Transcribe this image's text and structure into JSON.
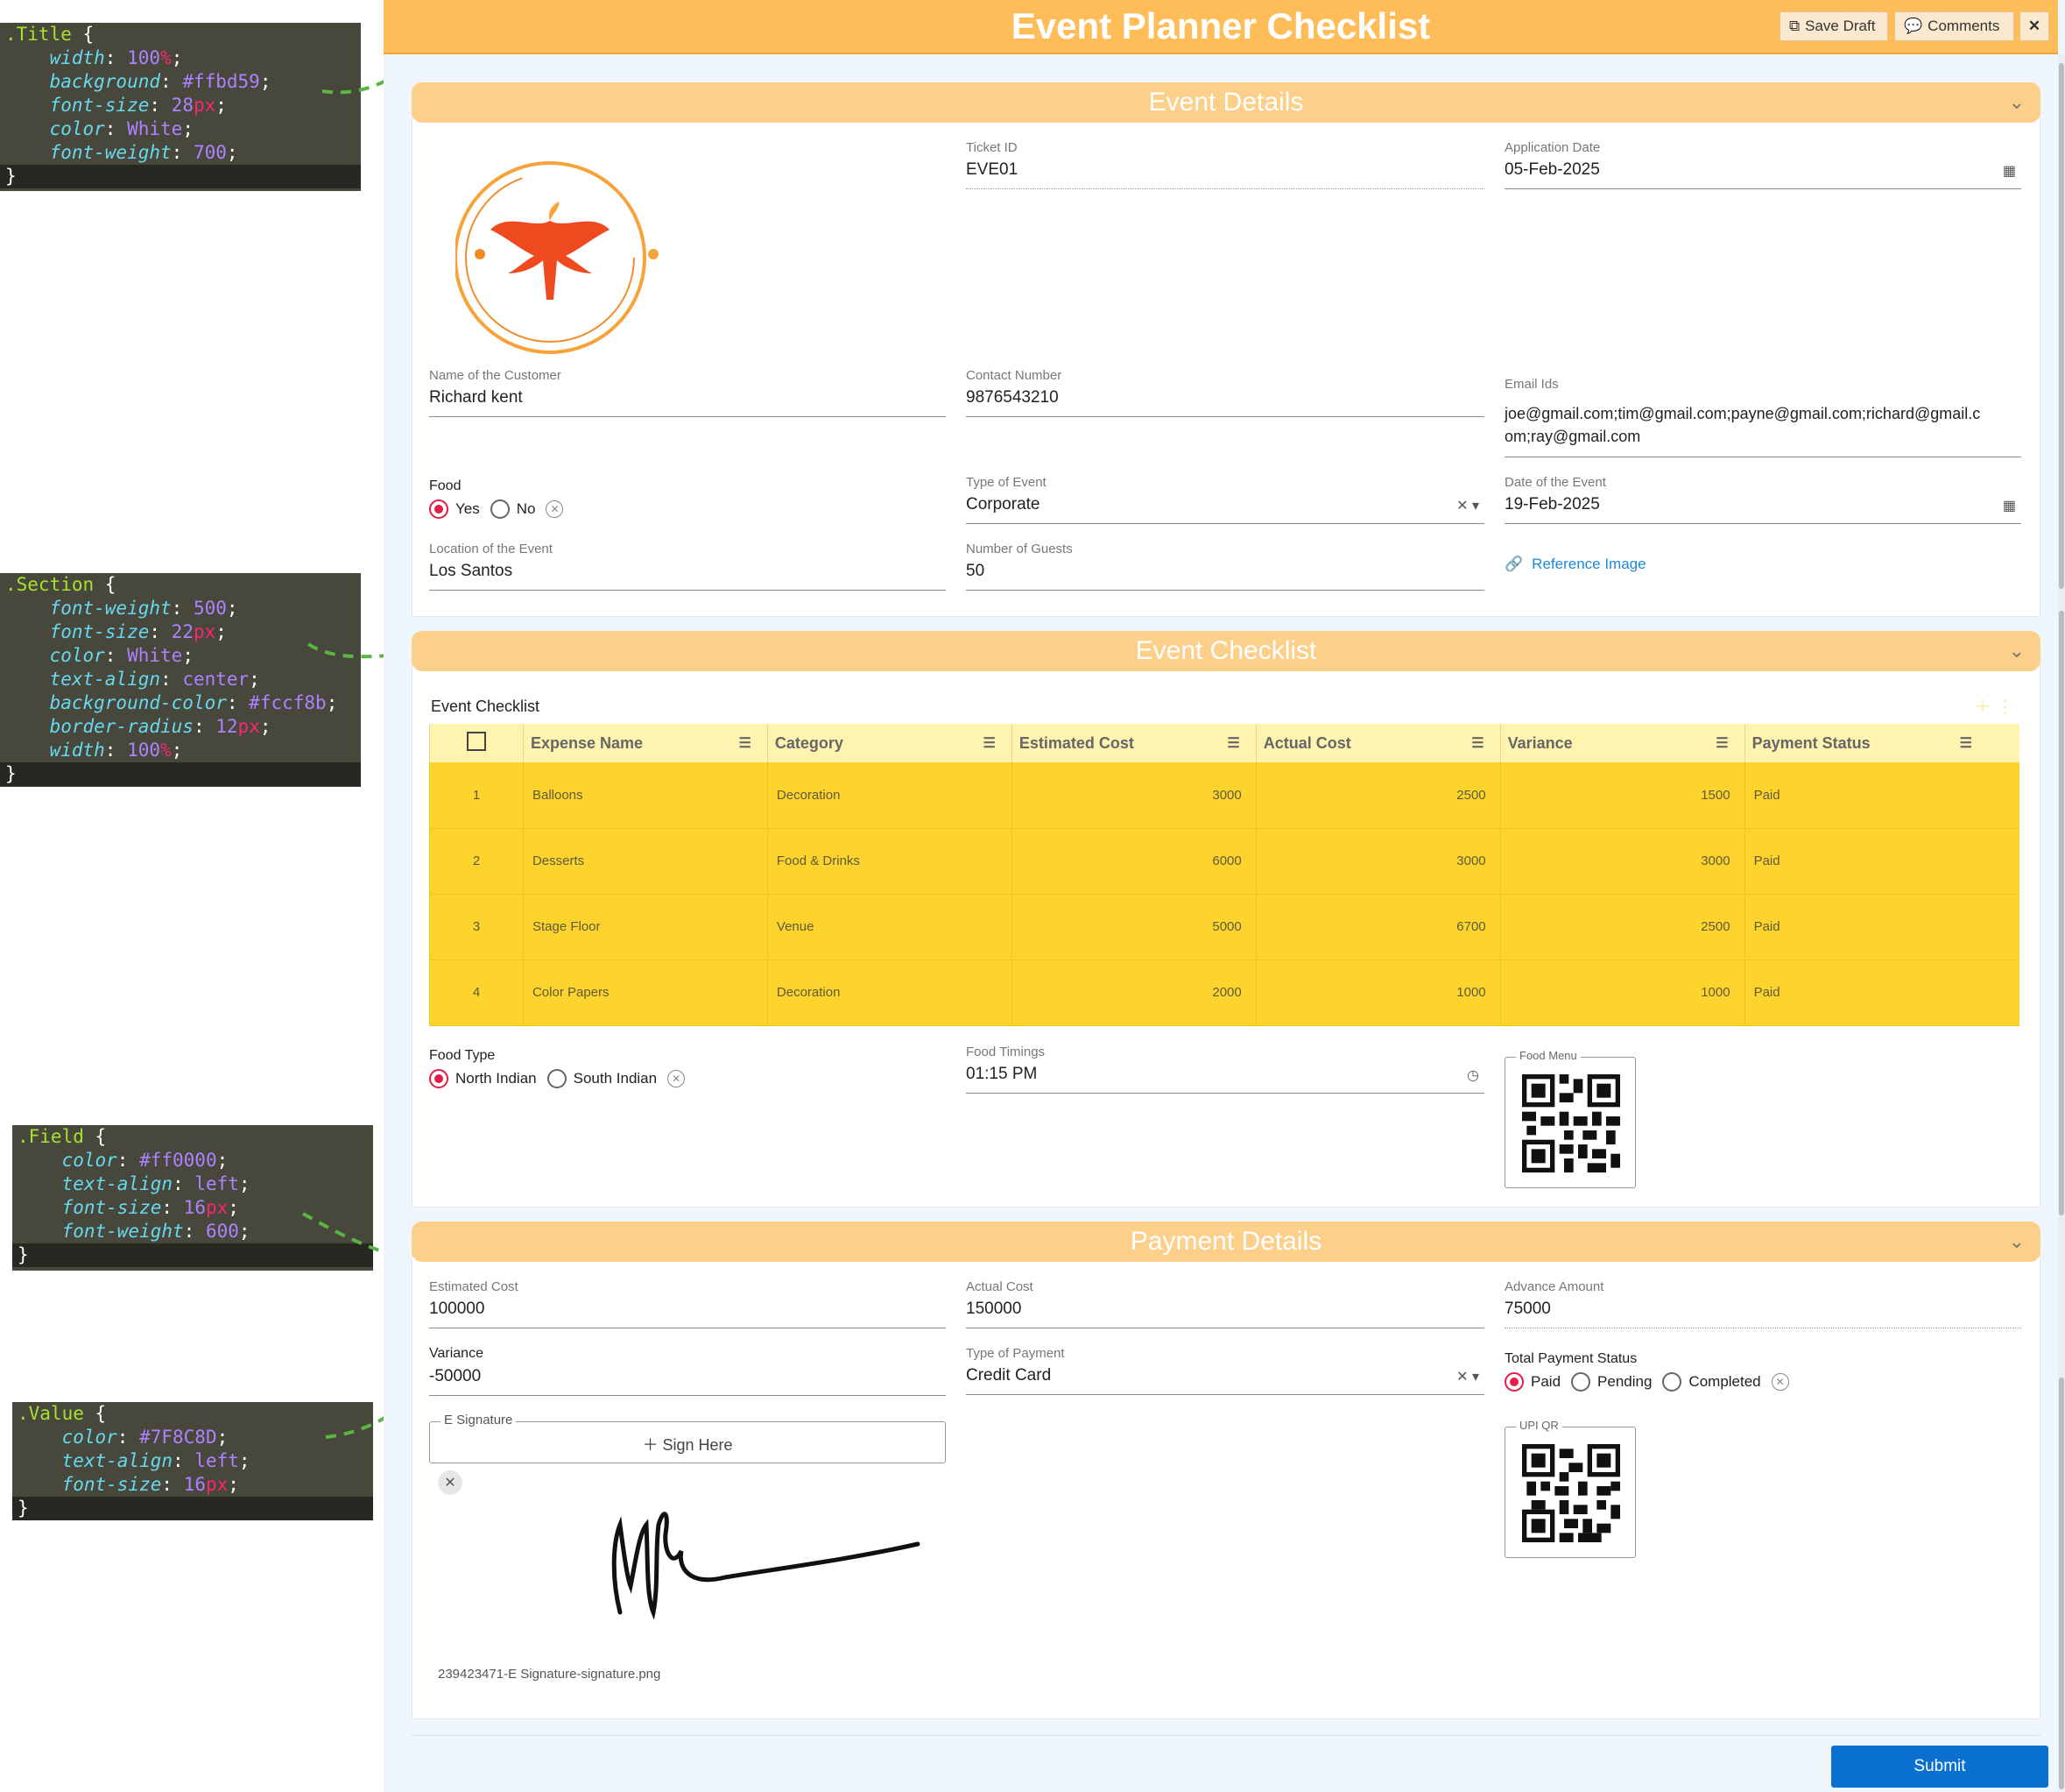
{
  "annotations": {
    "title_css": {
      "selector": ".Title",
      "lines": [
        {
          "prop": "width",
          "value": "100",
          "unit": "%"
        },
        {
          "prop": "background",
          "value": "#ffbd59",
          "unit": ""
        },
        {
          "prop": "font-size",
          "value": "28",
          "unit": "px"
        },
        {
          "prop": "color",
          "value": "White",
          "unit": ""
        },
        {
          "prop": "font-weight",
          "value": "700",
          "unit": ""
        }
      ]
    },
    "section_css": {
      "selector": ".Section",
      "lines": [
        {
          "prop": "font-weight",
          "value": "500",
          "unit": ""
        },
        {
          "prop": "font-size",
          "value": "22",
          "unit": "px"
        },
        {
          "prop": "color",
          "value": "White",
          "unit": ""
        },
        {
          "prop": "text-align",
          "value": "center",
          "unit": ""
        },
        {
          "prop": "background-color",
          "value": "#fccf8b",
          "unit": ""
        },
        {
          "prop": "border-radius",
          "value": "12",
          "unit": "px"
        },
        {
          "prop": "width",
          "value": "100",
          "unit": "%"
        }
      ]
    },
    "field_css": {
      "selector": ".Field",
      "lines": [
        {
          "prop": "color",
          "value": "#ff0000",
          "unit": ""
        },
        {
          "prop": "text-align",
          "value": "left",
          "unit": ""
        },
        {
          "prop": "font-size",
          "value": "16",
          "unit": "px"
        },
        {
          "prop": "font-weight",
          "value": "600",
          "unit": ""
        }
      ]
    },
    "value_css": {
      "selector": ".Value",
      "lines": [
        {
          "prop": "color",
          "value": "#7F8C8D",
          "unit": ""
        },
        {
          "prop": "text-align",
          "value": "left",
          "unit": ""
        },
        {
          "prop": "font-size",
          "value": "16",
          "unit": "px"
        }
      ]
    }
  },
  "header": {
    "title": "Event Planner Checklist",
    "save_draft": "Save Draft",
    "comments": "Comments",
    "close": "✕"
  },
  "event_details": {
    "section_title": "Event Details",
    "ticket_id_label": "Ticket ID",
    "ticket_id": "EVE01",
    "application_date_label": "Application Date",
    "application_date": "05-Feb-2025",
    "customer_label": "Name of the Customer",
    "customer": "Richard kent",
    "contact_label": "Contact Number",
    "contact": "9876543210",
    "email_label": "Email Ids",
    "email_line1": "joe@gmail.com;tim@gmail.com;payne@gmail.com;richard@gmail.c",
    "email_line2": "om;ray@gmail.com",
    "food_label": "Food",
    "food_yes": "Yes",
    "food_no": "No",
    "event_type_label": "Type of Event",
    "event_type": "Corporate",
    "event_date_label": "Date of the Event",
    "event_date": "19-Feb-2025",
    "location_label": "Location of the Event",
    "location": "Los Santos",
    "guests_label": "Number of Guests",
    "guests": "50",
    "reference_image": "Reference Image"
  },
  "checklist": {
    "section_title": "Event Checklist",
    "grid_title": "Event Checklist",
    "columns": [
      "Expense Name",
      "Category",
      "Estimated Cost",
      "Actual Cost",
      "Variance",
      "Payment Status"
    ],
    "rows": [
      {
        "idx": "1",
        "name": "Balloons",
        "category": "Decoration",
        "estimated": "3000",
        "actual": "2500",
        "variance": "1500",
        "status": "Paid"
      },
      {
        "idx": "2",
        "name": "Desserts",
        "category": "Food & Drinks",
        "estimated": "6000",
        "actual": "3000",
        "variance": "3000",
        "status": "Paid"
      },
      {
        "idx": "3",
        "name": "Stage Floor",
        "category": "Venue",
        "estimated": "5000",
        "actual": "6700",
        "variance": "2500",
        "status": "Paid"
      },
      {
        "idx": "4",
        "name": "Color Papers",
        "category": "Decoration",
        "estimated": "2000",
        "actual": "1000",
        "variance": "1000",
        "status": "Paid"
      }
    ],
    "food_type_label": "Food Type",
    "food_type_north": "North Indian",
    "food_type_south": "South Indian",
    "food_timings_label": "Food Timings",
    "food_timings": "01:15 PM",
    "food_menu_label": "Food Menu"
  },
  "payment": {
    "section_title": "Payment Details",
    "estimated_label": "Estimated Cost",
    "estimated": "100000",
    "actual_label": "Actual Cost",
    "actual": "150000",
    "advance_label": "Advance Amount",
    "advance": "75000",
    "variance_label": "Variance",
    "variance": "-50000",
    "payment_type_label": "Type of Payment",
    "payment_type": "Credit Card",
    "total_status_label": "Total Payment Status",
    "status_paid": "Paid",
    "status_pending": "Pending",
    "status_completed": "Completed",
    "esign_label": "E Signature",
    "sign_here": "Sign Here",
    "upi_label": "UPI QR",
    "signature_file": "239423471-E Signature-signature.png"
  },
  "submit": "Submit",
  "colors": {
    "title_bg": "#ffbd59",
    "section_bg": "#fccf8b",
    "row_bg": "#fdd42e",
    "header_row_bg": "#fff3b0",
    "accent_radio": "#e11d48",
    "submit_bg": "#0a70d1"
  }
}
